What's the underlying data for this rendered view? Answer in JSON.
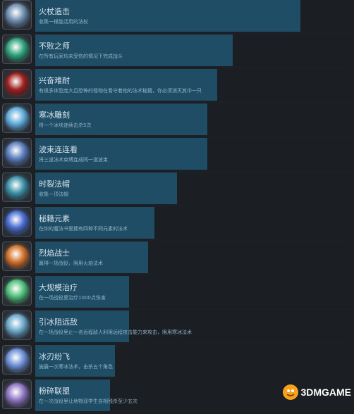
{
  "achievements": [
    {
      "title": "火杖造击",
      "desc": "收集一根能活用的法杖",
      "progress": 0.836,
      "icon": "magic-staff-icon",
      "accent": "#6f8db0"
    },
    {
      "title": "不败之师",
      "desc": "在所有玩家均未受伤的情况下完成战斗",
      "progress": 0.622,
      "icon": "green-arrows-icon",
      "accent": "#2fa37c"
    },
    {
      "title": "兴奋难耐",
      "desc": "有很多体型庞大且恐怖的怪物在看守着他的法术秘籍，你必须消灭其中一只",
      "progress": 0.574,
      "icon": "demon-eye-icon",
      "accent": "#a02020"
    },
    {
      "title": "寒冰雕刻",
      "desc": "将一个冰块连续击杀5次",
      "progress": 0.542,
      "icon": "ice-orb-icon",
      "accent": "#5fa9d8"
    },
    {
      "title": "波束连连看",
      "desc": "将三道法术束缚连成同一道波束",
      "progress": 0.542,
      "icon": "beam-icon",
      "accent": "#5c7fbf"
    },
    {
      "title": "时裂法帽",
      "desc": "收集一顶法帽",
      "progress": 0.447,
      "icon": "wizard-hat-icon",
      "accent": "#3b8fa6"
    },
    {
      "title": "秘籍元素",
      "desc": "在你的魔法书里拥有四种不同元素的法术",
      "progress": 0.376,
      "icon": "element-orb-icon",
      "accent": "#4a6dd1"
    },
    {
      "title": "烈焰战士",
      "desc": "赢得一场战役，限用火焰法术",
      "progress": 0.356,
      "icon": "flame-warrior-icon",
      "accent": "#d0702a"
    },
    {
      "title": "大规模治疗",
      "desc": "在一场战役里治疗1000点伤害",
      "progress": 0.296,
      "icon": "heal-icon",
      "accent": "#4fbf7a"
    },
    {
      "title": "引冰阻远敌",
      "desc": "在一场战役里止一名远程敌人利用远程攻击能力来攻击，限用寒冰法术",
      "progress": 0.296,
      "icon": "ice-hand-icon",
      "accent": "#6aa6c9"
    },
    {
      "title": "冰刃纷飞",
      "desc": "施展一次寒冰法术，击杀五个角色",
      "progress": 0.251,
      "icon": "ice-blades-icon",
      "accent": "#6c8fd6"
    },
    {
      "title": "粉碎联盟",
      "desc": "在一次战役里让地物双学生自相残杀至少五次",
      "progress": 0.236,
      "icon": "shattered-alliance-icon",
      "accent": "#8e74c2"
    }
  ],
  "watermark": {
    "text": "3DMGAME"
  }
}
